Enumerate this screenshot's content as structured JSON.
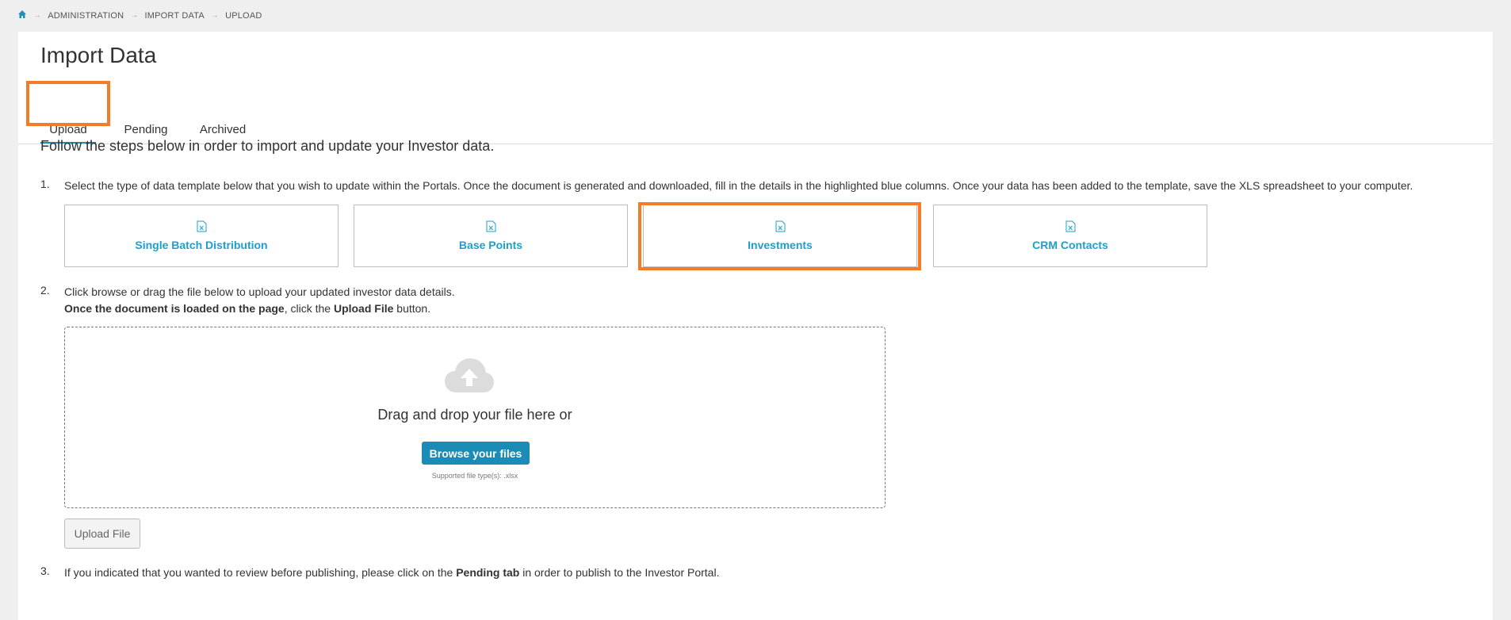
{
  "breadcrumb": {
    "icon": "home-icon",
    "items": [
      "ADMINISTRATION",
      "IMPORT DATA",
      "UPLOAD"
    ]
  },
  "page": {
    "title": "Import Data"
  },
  "tabs": [
    {
      "label": "Upload",
      "active": true
    },
    {
      "label": "Pending",
      "active": false
    },
    {
      "label": "Archived",
      "active": false
    }
  ],
  "intro": "Follow the steps below in order to import and update your Investor data.",
  "steps": {
    "s1": {
      "num": "1.",
      "text": "Select the type of data template below that you wish to update within the Portals. Once the document is generated and downloaded, fill in the details in the highlighted blue columns. Once your data has been added to the template, save the XLS spreadsheet to your computer."
    },
    "s2": {
      "num": "2.",
      "line1": "Click browse or drag the file below to upload your updated investor data details.",
      "line2_bold": "Once the document is loaded on the page",
      "line2_mid": ", click the ",
      "line2_bold2": "Upload File",
      "line2_end": " button."
    },
    "s3": {
      "num": "3.",
      "pre": "If you indicated that you wanted to review before publishing, please click on the ",
      "bold": "Pending tab",
      "post": " in order to publish to the Investor Portal."
    }
  },
  "templates": [
    {
      "label": "Single Batch Distribution",
      "icon": "excel-file-icon"
    },
    {
      "label": "Base Points",
      "icon": "excel-file-icon"
    },
    {
      "label": "Investments",
      "icon": "excel-file-icon"
    },
    {
      "label": "CRM Contacts",
      "icon": "excel-file-icon"
    }
  ],
  "dropzone": {
    "icon": "cloud-upload-icon",
    "text": "Drag and drop your file here or",
    "browse_label": "Browse your files",
    "supported": "Supported file type(s): .xlsx"
  },
  "upload_label": "Upload File",
  "colors": {
    "accent": "#1a8cb5",
    "link": "#1aa0cf",
    "highlight": "#f47c28"
  }
}
